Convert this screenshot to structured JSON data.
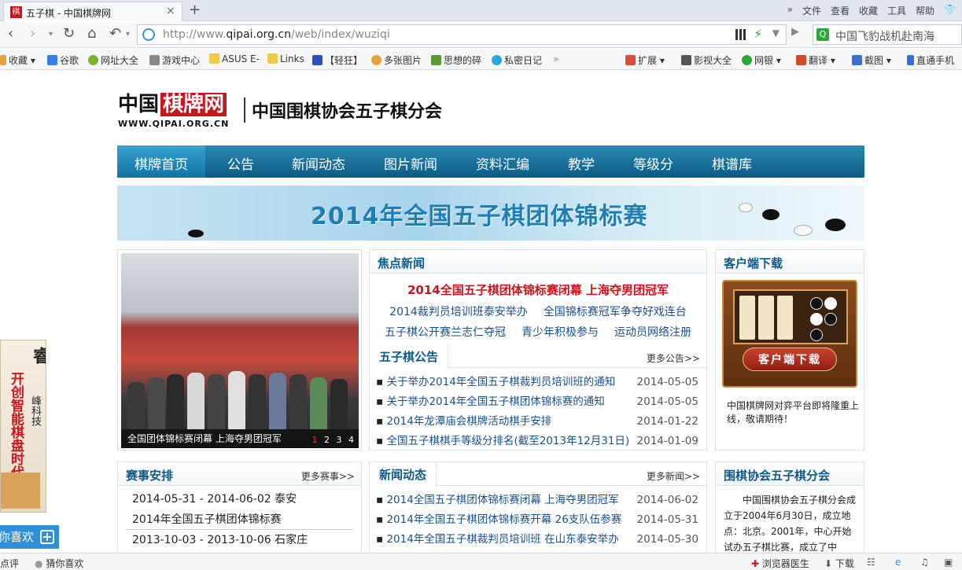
{
  "browser": {
    "tab_title": "五子棋 - 中国棋牌网",
    "tab_favicon": "棋",
    "top_menu": [
      "»",
      "文件",
      "查看",
      "收藏",
      "工具",
      "帮助"
    ],
    "url_prefix": "http://www.",
    "url_domain": "qipai.org.cn",
    "url_path": "/web/index/wuziqi",
    "search_text": "中国飞豹战机赴南海",
    "search_icon_text": "Q"
  },
  "bookmarks": [
    "收藏",
    "谷歌",
    "网址大全",
    "游戏中心",
    "ASUS E-",
    "Links",
    "【轻狂】",
    "多张图片",
    "思想的碎",
    "私密日记",
    "»",
    "扩展",
    "影视大全",
    "网银",
    "翻译",
    "截图",
    "直通手机"
  ],
  "site": {
    "logo_cn": "中国",
    "logo_red": "棋牌网",
    "logo_url": "WWW.QIPAI.ORG.CN",
    "name": "中国围棋协会五子棋分会"
  },
  "nav": [
    "棋牌首页",
    "公告",
    "新闻动态",
    "图片新闻",
    "资料汇编",
    "教学",
    "等级分",
    "棋谱库"
  ],
  "banner": {
    "text": "2014年全国五子棋团体锦标赛"
  },
  "photo": {
    "caption": "全国团体锦标赛闭幕 上海夺男团冠军",
    "pages": [
      "1",
      "2",
      "3",
      "4"
    ]
  },
  "focus": {
    "title": "焦点新闻",
    "headline": "2014全国五子棋团体锦标赛闭幕 上海夺男团冠军",
    "row1": [
      "2014裁判员培训班泰安举办",
      "全国锦标赛冠军争夺好戏连台"
    ],
    "row2": [
      "五子棋公开赛兰志仁夺冠",
      "青少年积极参与",
      "运动员网络注册"
    ]
  },
  "notices": {
    "title": "五子棋公告",
    "more": "更多公告>>",
    "items": [
      {
        "t": "关于举办2014年全国五子棋裁判员培训班的通知",
        "d": "2014-05-05"
      },
      {
        "t": "关于举办2014年全国五子棋团体锦标赛的通知",
        "d": "2014-05-05"
      },
      {
        "t": "2014年龙潭庙会棋牌活动棋手安排",
        "d": "2014-01-22"
      },
      {
        "t": "全国五子棋棋手等级分排名(截至2013年12月31日)",
        "d": "2014-01-09"
      }
    ]
  },
  "news": {
    "title": "新闻动态",
    "more": "更多新闻>>",
    "items": [
      {
        "t": "2014全国五子棋团体锦标赛闭幕 上海夺男团冠军",
        "d": "2014-06-02"
      },
      {
        "t": "2014年全国五子棋团体锦标赛开幕 26支队伍参赛",
        "d": "2014-05-31"
      },
      {
        "t": "2014年全国五子棋裁判员培训班 在山东泰安举办",
        "d": "2014-05-30"
      }
    ]
  },
  "schedule": {
    "title": "赛事安排",
    "more": "更多赛事>>",
    "rows": [
      "2014-05-31 - 2014-06-02  泰安",
      "2014年全国五子棋团体锦标赛",
      "2013-10-03 - 2013-10-06  石家庄"
    ]
  },
  "client": {
    "title": "客户端下载",
    "button": "客户端下载",
    "text": "中国棋牌网对弈平台即将隆重上线，敬请期待！"
  },
  "about": {
    "title": "围棋协会五子棋分会",
    "text": "中国围棋协会五子棋分会成立于2004年6月30日，成立地点：北京。2001年，中心开始试办五子棋比赛，成立了中"
  },
  "side_ad": {
    "c1": "睿",
    "c2": "峰科技",
    "c3": "开创智能棋盘时代"
  },
  "like_button": "你喜欢",
  "statusbar": {
    "left1": "点评",
    "left2": "猜你喜欢",
    "right1": "浏览器医生",
    "right2": "下载"
  },
  "colors": {
    "nav_blue": "#0d5a84",
    "accent_red": "#d0121b",
    "link_blue": "#1a4f8b"
  }
}
